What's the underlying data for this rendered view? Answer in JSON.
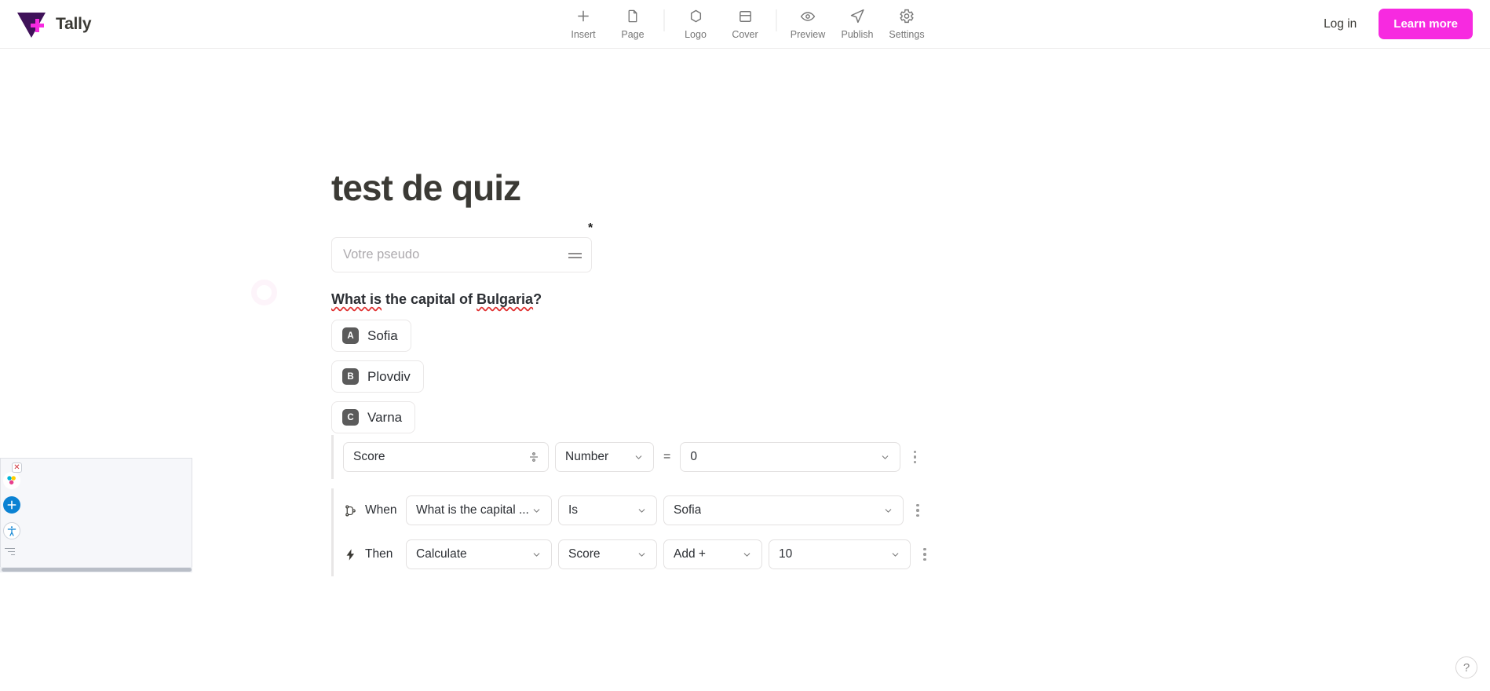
{
  "brand": {
    "name": "Tally",
    "logo_icon": "tally-logo-icon"
  },
  "toolbar": {
    "items": [
      {
        "label": "Insert",
        "icon": "plus-icon"
      },
      {
        "label": "Page",
        "icon": "page-document-icon"
      },
      {
        "label": "Logo",
        "icon": "hexagon-logo-icon"
      },
      {
        "label": "Cover",
        "icon": "cover-rectangle-icon"
      },
      {
        "label": "Preview",
        "icon": "eye-icon"
      },
      {
        "label": "Publish",
        "icon": "send-paper-plane-icon"
      },
      {
        "label": "Settings",
        "icon": "gear-icon"
      }
    ]
  },
  "header_actions": {
    "login_label": "Log in",
    "learn_more_label": "Learn more",
    "accent_color": "#F72AE0"
  },
  "form": {
    "title": "test de quiz",
    "pseudo_field": {
      "placeholder": "Votre pseudo",
      "value": "",
      "required_marker": "*",
      "drag_handle_icon": "drag-handle-icon"
    },
    "question": {
      "part_1": "What is",
      "part_2": " the capital of ",
      "part_3": "Bulgaria",
      "part_4": "?",
      "spellcheck_color": "#e03131"
    },
    "options": [
      {
        "key": "A",
        "label": "Sofia"
      },
      {
        "key": "B",
        "label": "Plovdiv"
      },
      {
        "key": "C",
        "label": "Varna"
      }
    ]
  },
  "logic": {
    "calculation_row": {
      "variable": "Score",
      "variable_icon": "fraction-icon",
      "type": "Number",
      "operator": "=",
      "value": "0",
      "menu_icon": "kebab-menu-icon"
    },
    "when_row": {
      "icon": "branch-icon",
      "label": "When",
      "field": "What is the capital ...",
      "condition": "Is",
      "answer": "Sofia",
      "menu_icon": "kebab-menu-icon"
    },
    "then_row": {
      "icon": "lightning-bolt-icon",
      "label": "Then",
      "action": "Calculate",
      "target": "Score",
      "operation": "Add +",
      "amount": "10",
      "menu_icon": "kebab-menu-icon"
    }
  },
  "overlay_widgets": {
    "close_icon": "close-x-icon",
    "color_wheel_icon": "color-wheel-icon",
    "add_circle_icon": "add-circle-icon",
    "accessibility_icon": "accessibility-icon",
    "resize_icon": "resize-grip-icon",
    "scrollbar_icon": "horizontal-scrollbar"
  },
  "help": {
    "label": "?"
  }
}
